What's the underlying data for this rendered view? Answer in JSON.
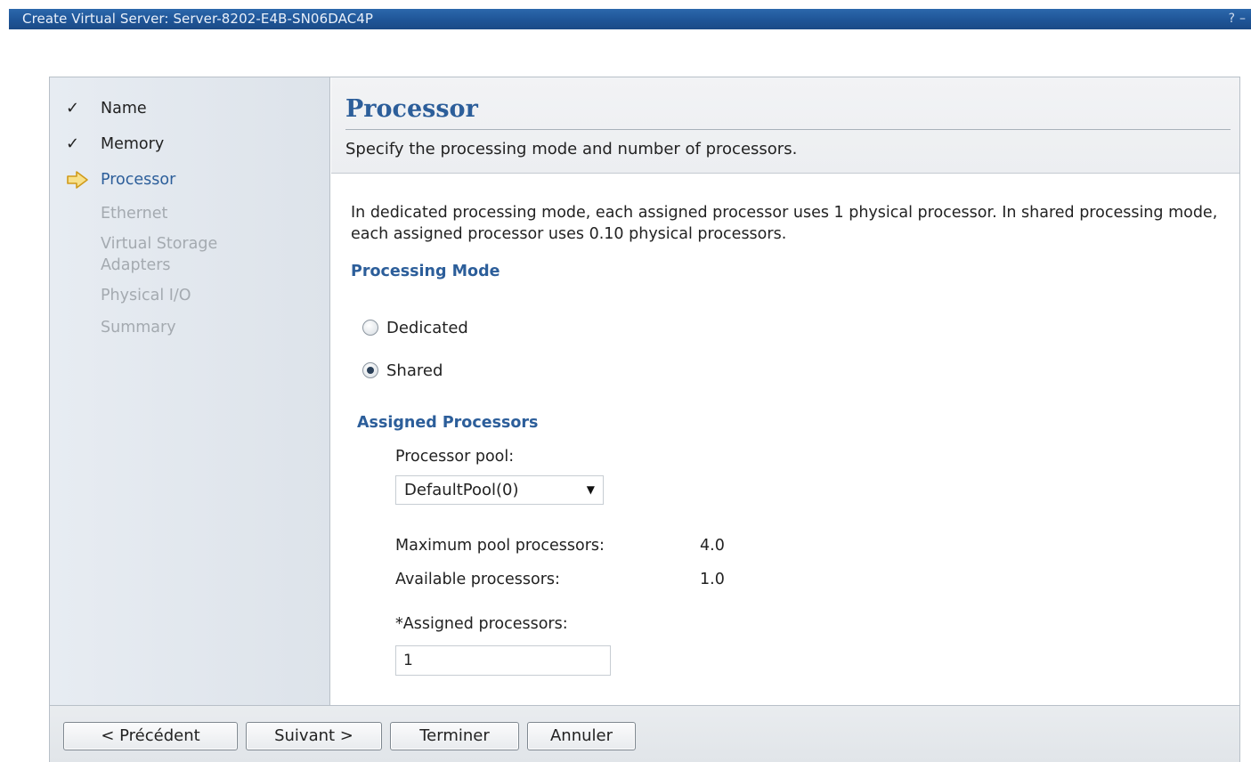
{
  "window": {
    "title": "Create Virtual Server: Server-8202-E4B-SN06DAC4P",
    "help_glyph": "?",
    "minimize_glyph": "–"
  },
  "nav": {
    "items": [
      {
        "label": "Name",
        "state": "done",
        "mark": "✓"
      },
      {
        "label": "Memory",
        "state": "done",
        "mark": "✓"
      },
      {
        "label": "Processor",
        "state": "current",
        "mark": "⇨"
      },
      {
        "label": "Ethernet",
        "state": "future"
      },
      {
        "label": "Virtual Storage Adapters",
        "state": "future"
      },
      {
        "label": "Physical I/O",
        "state": "future"
      },
      {
        "label": "Summary",
        "state": "future"
      }
    ]
  },
  "page": {
    "title": "Processor",
    "description": "Specify the processing mode and number of processors.",
    "intro": "In dedicated processing mode, each assigned processor uses 1 physical processor. In shared processing mode, each assigned processor uses 0.10 physical processors."
  },
  "processing_mode": {
    "heading": "Processing Mode",
    "options": [
      {
        "label": "Dedicated",
        "checked": false
      },
      {
        "label": "Shared",
        "checked": true
      }
    ]
  },
  "assigned": {
    "heading": "Assigned Processors",
    "pool_label": "Processor pool:",
    "pool_value": "DefaultPool(0)",
    "max_label": "Maximum pool processors:",
    "max_value": "4.0",
    "available_label": "Available processors:",
    "available_value": "1.0",
    "assigned_label": "*Assigned processors:",
    "assigned_value": "1"
  },
  "footer": {
    "back": "< Précédent",
    "next": "Suivant >",
    "finish": "Terminer",
    "cancel": "Annuler"
  },
  "colors": {
    "title_bar": "#1f5597",
    "accent_text": "#2c5e9a",
    "disabled_text": "#a4aab0",
    "current_arrow": "#e0a020"
  }
}
